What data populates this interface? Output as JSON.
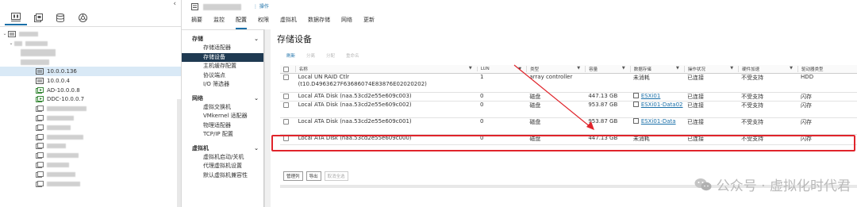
{
  "header": {
    "actions_label": "操作",
    "tabs": [
      "摘要",
      "监控",
      "配置",
      "权限",
      "虚拟机",
      "数据存储",
      "网络",
      "更新"
    ]
  },
  "inventory": {
    "nodes": [
      {
        "label": "10.0.0.136",
        "icon": "host-icon",
        "selected": true
      },
      {
        "label": "10.0.0.4",
        "icon": "host-icon"
      },
      {
        "label": "AD-10.0.0.8",
        "icon": "vm-icon"
      },
      {
        "label": "DDC-10.0.0.7",
        "icon": "vm-icon"
      }
    ]
  },
  "nav": {
    "sections": [
      {
        "title": "存储",
        "items": [
          "存储适配器",
          "存储设备",
          "主机缓存配置",
          "协议端点",
          "I/O 筛选器"
        ]
      },
      {
        "title": "网络",
        "items": [
          "虚拟交换机",
          "VMkernel 适配器",
          "物理适配器",
          "TCP/IP 配置"
        ]
      },
      {
        "title": "虚拟机",
        "items": [
          "虚拟机启动/关机",
          "代理虚拟机设置",
          "默认虚拟机兼容性"
        ]
      }
    ],
    "active": "存储设备"
  },
  "main": {
    "title": "存储设备",
    "toolbar": {
      "refresh": "刷新",
      "detach": "分离",
      "rescan": "分配",
      "rename": "重命名"
    },
    "columns": [
      "名称",
      "LUN",
      "类型",
      "容量",
      "数据存储",
      "操作状况",
      "硬件加速",
      "驱动器类型"
    ],
    "rows": [
      {
        "name": "Local UN RAID Ctlr (t10.D4963627F63686074E83876E02020202)",
        "lun": "1",
        "type": "array controller",
        "capacity": "",
        "datastore": "未消耗",
        "ds_link": false,
        "status": "已连接",
        "hw": "不受支持",
        "drive": "HDD"
      },
      {
        "name": "Local ATA Disk (naa.53cd2e55e609c003)",
        "lun": "0",
        "type": "磁盘",
        "capacity": "447.13 GB",
        "datastore": "ESXi01",
        "ds_link": true,
        "status": "已连接",
        "hw": "不受支持",
        "drive": "闪存"
      },
      {
        "name": "Local ATA Disk (naa.53cd2e55e609c002)",
        "lun": "0",
        "type": "磁盘",
        "capacity": "953.87 GB",
        "datastore": "ESXi01-Data02",
        "ds_link": true,
        "status": "已连接",
        "hw": "不受支持",
        "drive": "闪存"
      },
      {
        "name": "Local ATA Disk (naa.53cd2e55e609c001)",
        "lun": "0",
        "type": "磁盘",
        "capacity": "953.87 GB",
        "datastore": "ESXi01-Data",
        "ds_link": true,
        "status": "已连接",
        "hw": "不受支持",
        "drive": "闪存"
      },
      {
        "name": "Local ATA Disk (naa.53cd2e55e609c000)",
        "lun": "0",
        "type": "磁盘",
        "capacity": "447.13 GB",
        "datastore": "未消耗",
        "ds_link": false,
        "status": "已连接",
        "hw": "不受支持",
        "drive": "闪存"
      }
    ],
    "bottom_buttons": [
      "管理列",
      "导出",
      "取消全选"
    ]
  },
  "watermark": "公众号 · 虚拟化时代君",
  "colors": {
    "accent": "#1a6fa8",
    "highlight": "#e0242b",
    "nav_active": "#1f3a52"
  }
}
